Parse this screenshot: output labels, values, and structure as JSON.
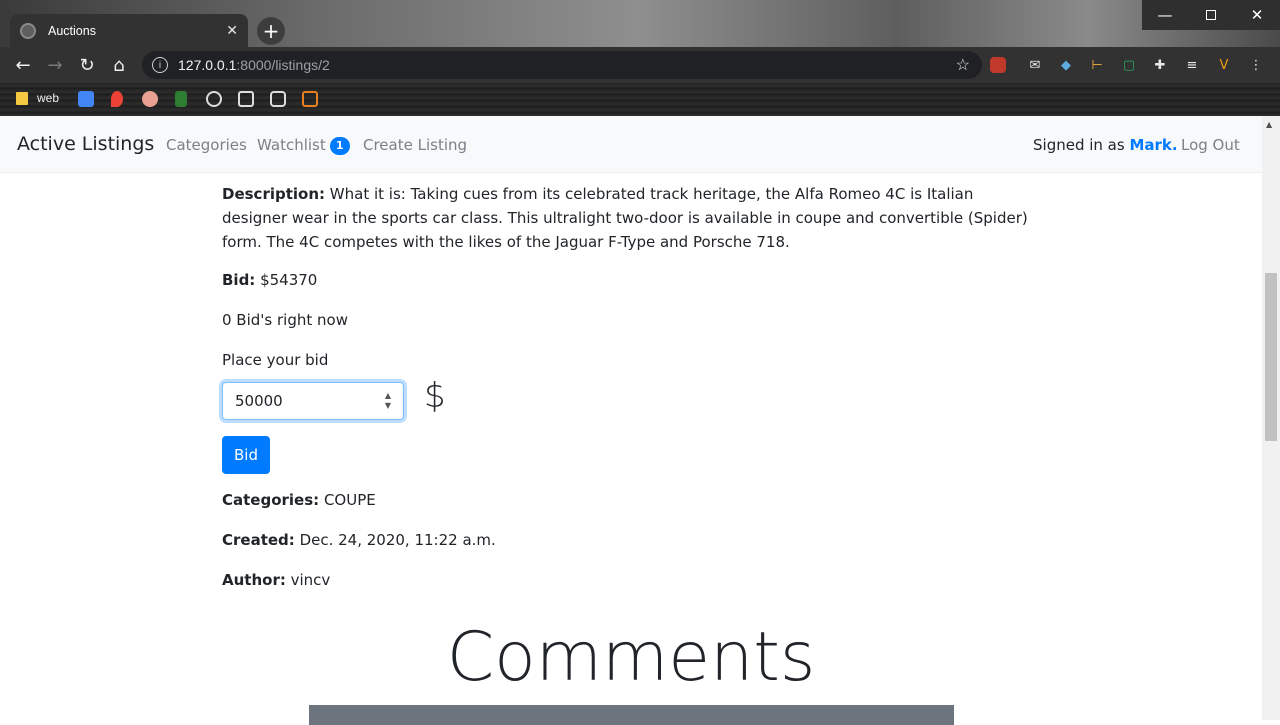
{
  "browser": {
    "tab_title": "Auctions",
    "tab_close": "✕",
    "new_tab": "+",
    "url_host": "127.0.0.1",
    "url_path": ":8000/listings/2",
    "bookmark_label": "web",
    "window_controls": {
      "minimize": "—",
      "close": "✕"
    },
    "nav": {
      "back": "←",
      "forward": "→",
      "reload": "↻",
      "home": "⌂",
      "star": "☆"
    }
  },
  "navbar": {
    "brand": "Active Listings",
    "links": [
      "Categories",
      "Watchlist",
      "Create Listing"
    ],
    "watchlist_count": "1",
    "signed_in_prefix": "Signed in as",
    "username": "Mark.",
    "logout": "Log Out"
  },
  "listing": {
    "description_label": "Description:",
    "description_text": "What it is: Taking cues from its celebrated track heritage, the Alfa Romeo 4C is Italian designer wear in the sports car class. This ultralight two-door is available in coupe and convertible (Spider) form. The 4C competes with the likes of the Jaguar F-Type and Porsche 718.",
    "bid_label": "Bid:",
    "bid_value": "$54370",
    "bid_count_text": "0 Bid's right now",
    "place_bid_label": "Place your bid",
    "bid_input_value": "50000",
    "currency_symbol": "$",
    "bid_button": "Bid",
    "categories_label": "Categories:",
    "categories_value": "COUPE",
    "created_label": "Created:",
    "created_value": "Dec. 24, 2020, 11:22 a.m.",
    "author_label": "Author:",
    "author_value": "vincv"
  },
  "comments": {
    "title": "Comments"
  },
  "colors": {
    "primary": "#007bff",
    "navbar_bg": "#f8f9fa",
    "text": "#212529",
    "muted": "#7b8188"
  }
}
